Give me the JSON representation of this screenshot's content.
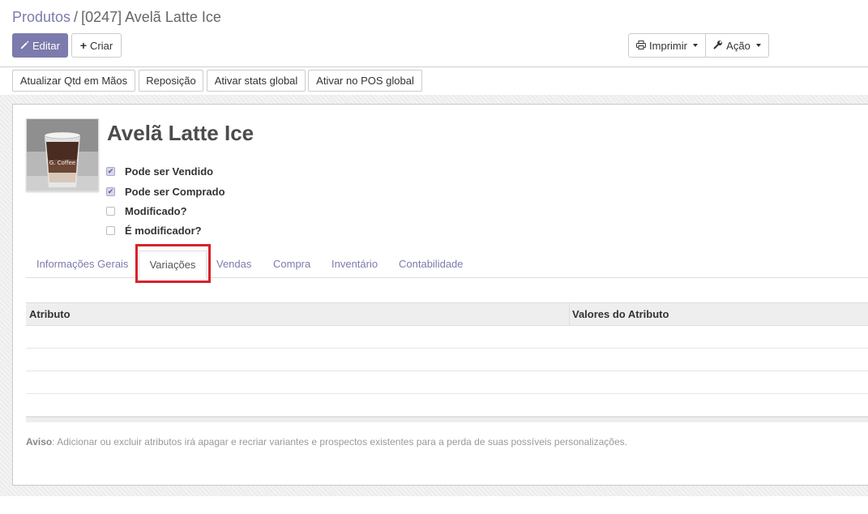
{
  "breadcrumb": {
    "parent": "Produtos",
    "separator": "/",
    "current": "[0247] Avelã Latte Ice"
  },
  "toolbar": {
    "edit": "Editar",
    "create": "Criar",
    "print": "Imprimir",
    "action": "Ação"
  },
  "header_buttons": [
    "Atualizar Qtd em Mãos",
    "Reposição",
    "Ativar stats global",
    "Ativar no POS global"
  ],
  "product": {
    "name": "Avelã Latte Ice",
    "image_text": "G. Coffee",
    "checkboxes": [
      {
        "label": "Pode ser Vendido",
        "checked": true
      },
      {
        "label": "Pode ser Comprado",
        "checked": true
      },
      {
        "label": "Modificado?",
        "checked": false
      },
      {
        "label": "É modificador?",
        "checked": false
      }
    ]
  },
  "tabs": [
    "Informações Gerais",
    "Variações",
    "Vendas",
    "Compra",
    "Inventário",
    "Contabilidade"
  ],
  "active_tab": "Variações",
  "table": {
    "columns": [
      "Atributo",
      "Valores do Atributo"
    ],
    "rows": []
  },
  "warning": {
    "prefix": "Aviso",
    "text": ": Adicionar ou excluir atributos irá apagar e recriar variantes e prospectos existentes para a perda de suas possíveis personalizações."
  },
  "colors": {
    "primary": "#7c7bad",
    "highlight": "#d6222a"
  }
}
